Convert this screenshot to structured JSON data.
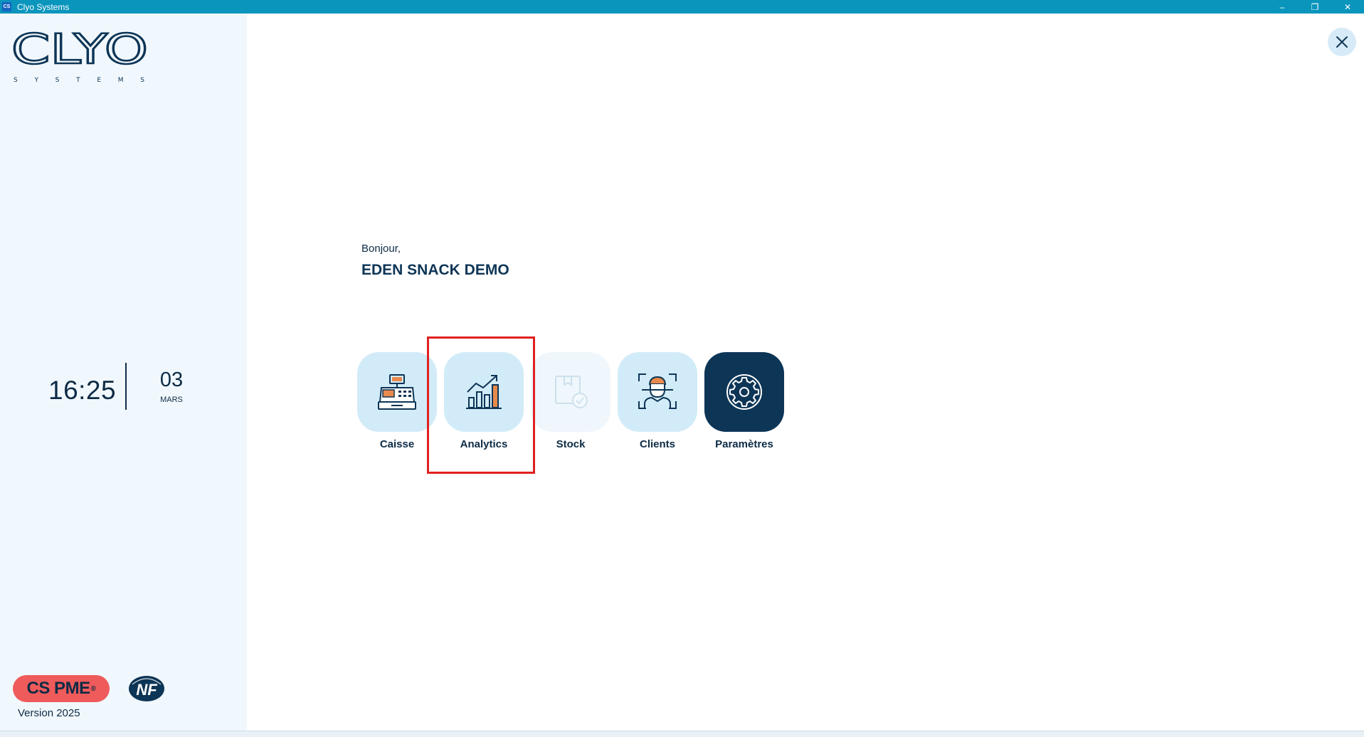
{
  "window": {
    "title": "Clyo Systems",
    "badge": "CS",
    "controls": {
      "minimize": "–",
      "restore": "❐",
      "close": "✕"
    }
  },
  "sidebar": {
    "logo": {
      "main": "CLYO",
      "sub": "SYSTEMS"
    },
    "time": "16:25",
    "day": "03",
    "month": "MARS",
    "badge": {
      "label": "CS PME",
      "mark": "®"
    },
    "nf_logo": "NF",
    "version": "Version 2025"
  },
  "main": {
    "greeting": "Bonjour,",
    "store_name": "EDEN SNACK DEMO",
    "tiles": [
      {
        "label": "Caisse",
        "icon": "cash-register-icon",
        "state": "active"
      },
      {
        "label": "Analytics",
        "icon": "chart-growth-icon",
        "state": "active"
      },
      {
        "label": "Stock",
        "icon": "stock-box-icon",
        "state": "disabled"
      },
      {
        "label": "Clients",
        "icon": "client-face-icon",
        "state": "active"
      },
      {
        "label": "Paramètres",
        "icon": "gear-icon",
        "state": "dark"
      }
    ]
  },
  "colors": {
    "titlebar": "#0a95bd",
    "sidebar_bg": "#f1f8fd",
    "tile_bg": "#d2ebf8",
    "tile_dark": "#0d3556",
    "accent_orange": "#e98a4c",
    "badge_red": "#ef5b5b",
    "highlight": "#e02020"
  }
}
